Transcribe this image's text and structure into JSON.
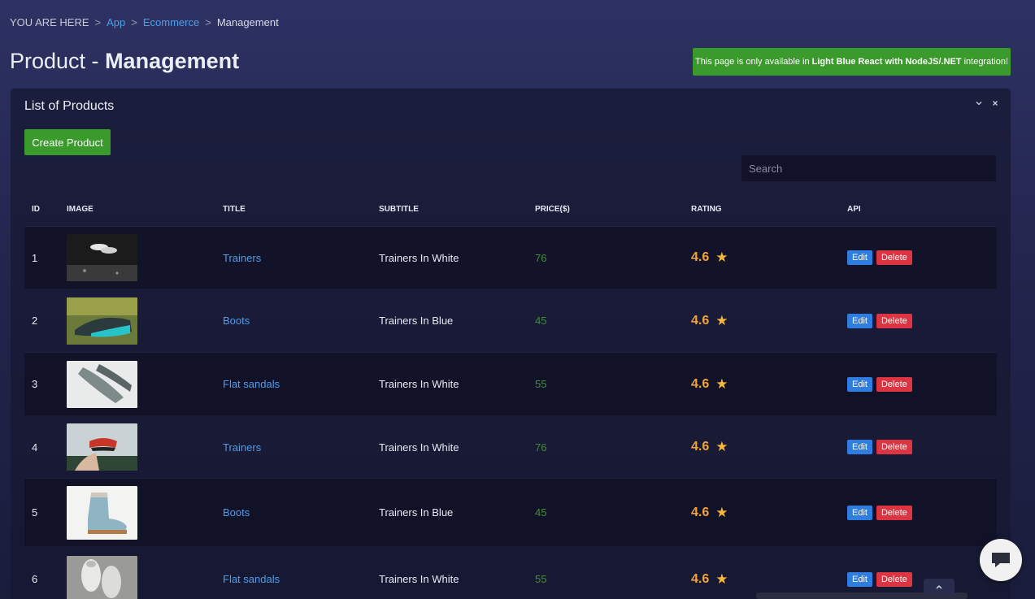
{
  "breadcrumb": {
    "prefix": "YOU ARE HERE",
    "items": [
      "App",
      "Ecommerce",
      "Management"
    ],
    "separator": ">"
  },
  "page_title": {
    "light": "Product -",
    "bold": "Management"
  },
  "notice": {
    "before": "This page is only available in",
    "bold": "Light Blue React with NodeJS/.NET",
    "after": "integration!"
  },
  "panel": {
    "title": "List of Products",
    "create_label": "Create Product",
    "search_placeholder": "Search"
  },
  "table": {
    "headers": [
      "ID",
      "IMAGE",
      "TITLE",
      "SUBTITLE",
      "PRICE($)",
      "RATING",
      "API"
    ],
    "rows": [
      {
        "id": "1",
        "title": "Trainers",
        "subtitle": "Trainers In White",
        "price": "76",
        "rating": "4.6"
      },
      {
        "id": "2",
        "title": "Boots",
        "subtitle": "Trainers In Blue",
        "price": "45",
        "rating": "4.6"
      },
      {
        "id": "3",
        "title": "Flat sandals",
        "subtitle": "Trainers In White",
        "price": "55",
        "rating": "4.6"
      },
      {
        "id": "4",
        "title": "Trainers",
        "subtitle": "Trainers In White",
        "price": "76",
        "rating": "4.6"
      },
      {
        "id": "5",
        "title": "Boots",
        "subtitle": "Trainers In Blue",
        "price": "45",
        "rating": "4.6"
      },
      {
        "id": "6",
        "title": "Flat sandals",
        "subtitle": "Trainers In White",
        "price": "55",
        "rating": "4.6"
      }
    ],
    "edit_label": "Edit",
    "delete_label": "Delete"
  },
  "icons": {
    "star": "star-icon",
    "chat": "chat-bubble-icon",
    "collapse": "chevron-down-icon",
    "close": "close-icon",
    "scroll_top": "chevron-up-icon"
  },
  "colors": {
    "accent_green": "#3a9b2c",
    "link_blue": "#4d9ee8",
    "edit_blue": "#2f7de0",
    "delete_red": "#dc3440",
    "rating_orange": "#f0a33a"
  }
}
